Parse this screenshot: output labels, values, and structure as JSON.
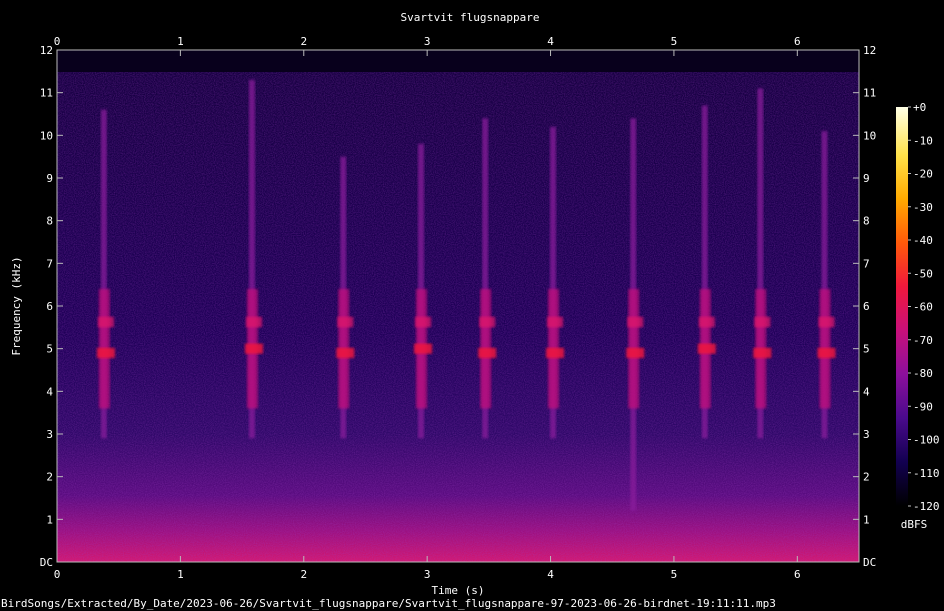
{
  "chart_data": {
    "type": "heatmap",
    "title": "Svartvit flugsnappare",
    "xlabel": "Time (s)",
    "ylabel": "Frequency (kHz)",
    "xlim": [
      0,
      6.5
    ],
    "ylim": [
      0,
      12
    ],
    "x_ticks": [
      "0",
      "1",
      "2",
      "3",
      "4",
      "5",
      "6"
    ],
    "y_ticks": [
      "DC",
      "1",
      "2",
      "3",
      "4",
      "5",
      "6",
      "7",
      "8",
      "9",
      "10",
      "11",
      "12"
    ],
    "colorbar": {
      "label": "dBFS",
      "ticks": [
        "+0",
        "-10",
        "-20",
        "-30",
        "-40",
        "-50",
        "-60",
        "-70",
        "-80",
        "-90",
        "-100",
        "-110",
        "-120"
      ],
      "range": [
        -120,
        0
      ],
      "colormap": [
        "#000000",
        "#120050",
        "#4a0a8c",
        "#8c0f9c",
        "#c8107a",
        "#f0183c",
        "#ff5a0a",
        "#ffaa00",
        "#ffe24a",
        "#ffffe6"
      ]
    },
    "calls": [
      {
        "t": 0.38,
        "f_low": 2.9,
        "f_high": 10.6,
        "peak_khz": 4.9
      },
      {
        "t": 1.58,
        "f_low": 2.9,
        "f_high": 11.3,
        "peak_khz": 5.0
      },
      {
        "t": 2.32,
        "f_low": 2.9,
        "f_high": 9.5,
        "peak_khz": 4.9
      },
      {
        "t": 2.95,
        "f_low": 2.9,
        "f_high": 9.8,
        "peak_khz": 5.0
      },
      {
        "t": 3.47,
        "f_low": 2.9,
        "f_high": 10.4,
        "peak_khz": 4.9
      },
      {
        "t": 4.02,
        "f_low": 2.9,
        "f_high": 10.2,
        "peak_khz": 4.9
      },
      {
        "t": 4.67,
        "f_low": 1.2,
        "f_high": 10.4,
        "peak_khz": 4.9
      },
      {
        "t": 5.25,
        "f_low": 2.9,
        "f_high": 10.7,
        "peak_khz": 5.0
      },
      {
        "t": 5.7,
        "f_low": 2.9,
        "f_high": 11.1,
        "peak_khz": 4.9
      },
      {
        "t": 6.22,
        "f_low": 2.9,
        "f_high": 10.1,
        "peak_khz": 4.9
      }
    ]
  },
  "footer": {
    "path": "BirdSongs/Extracted/By_Date/2023-06-26/Svartvit_flugsnappare/Svartvit_flugsnappare-97-2023-06-26-birdnet-19:11:11.mp3"
  }
}
